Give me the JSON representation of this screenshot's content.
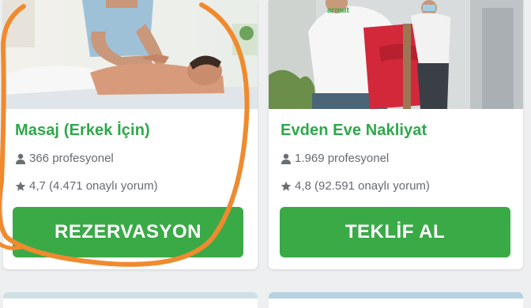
{
  "services": [
    {
      "title": "Masaj (Erkek İçin)",
      "professionals": "366 profesyonel",
      "rating": "4,7 (4.471 onaylı yorum)",
      "cta": "REZERVASYON"
    },
    {
      "title": "Evden Eve Nakliyat",
      "professionals": "1.969 profesyonel",
      "rating": "4,8 (92.591 onaylı yorum)",
      "cta": "TEKLİF AL",
      "photo_shirt_logo": "armut"
    }
  ],
  "colors": {
    "title_green": "#2da84a",
    "button_green": "#3aaa47",
    "annotation_orange": "#f08a2e",
    "meta_gray": "#666b70"
  },
  "icons": {
    "professionals": "person-icon",
    "rating": "star-icon"
  }
}
